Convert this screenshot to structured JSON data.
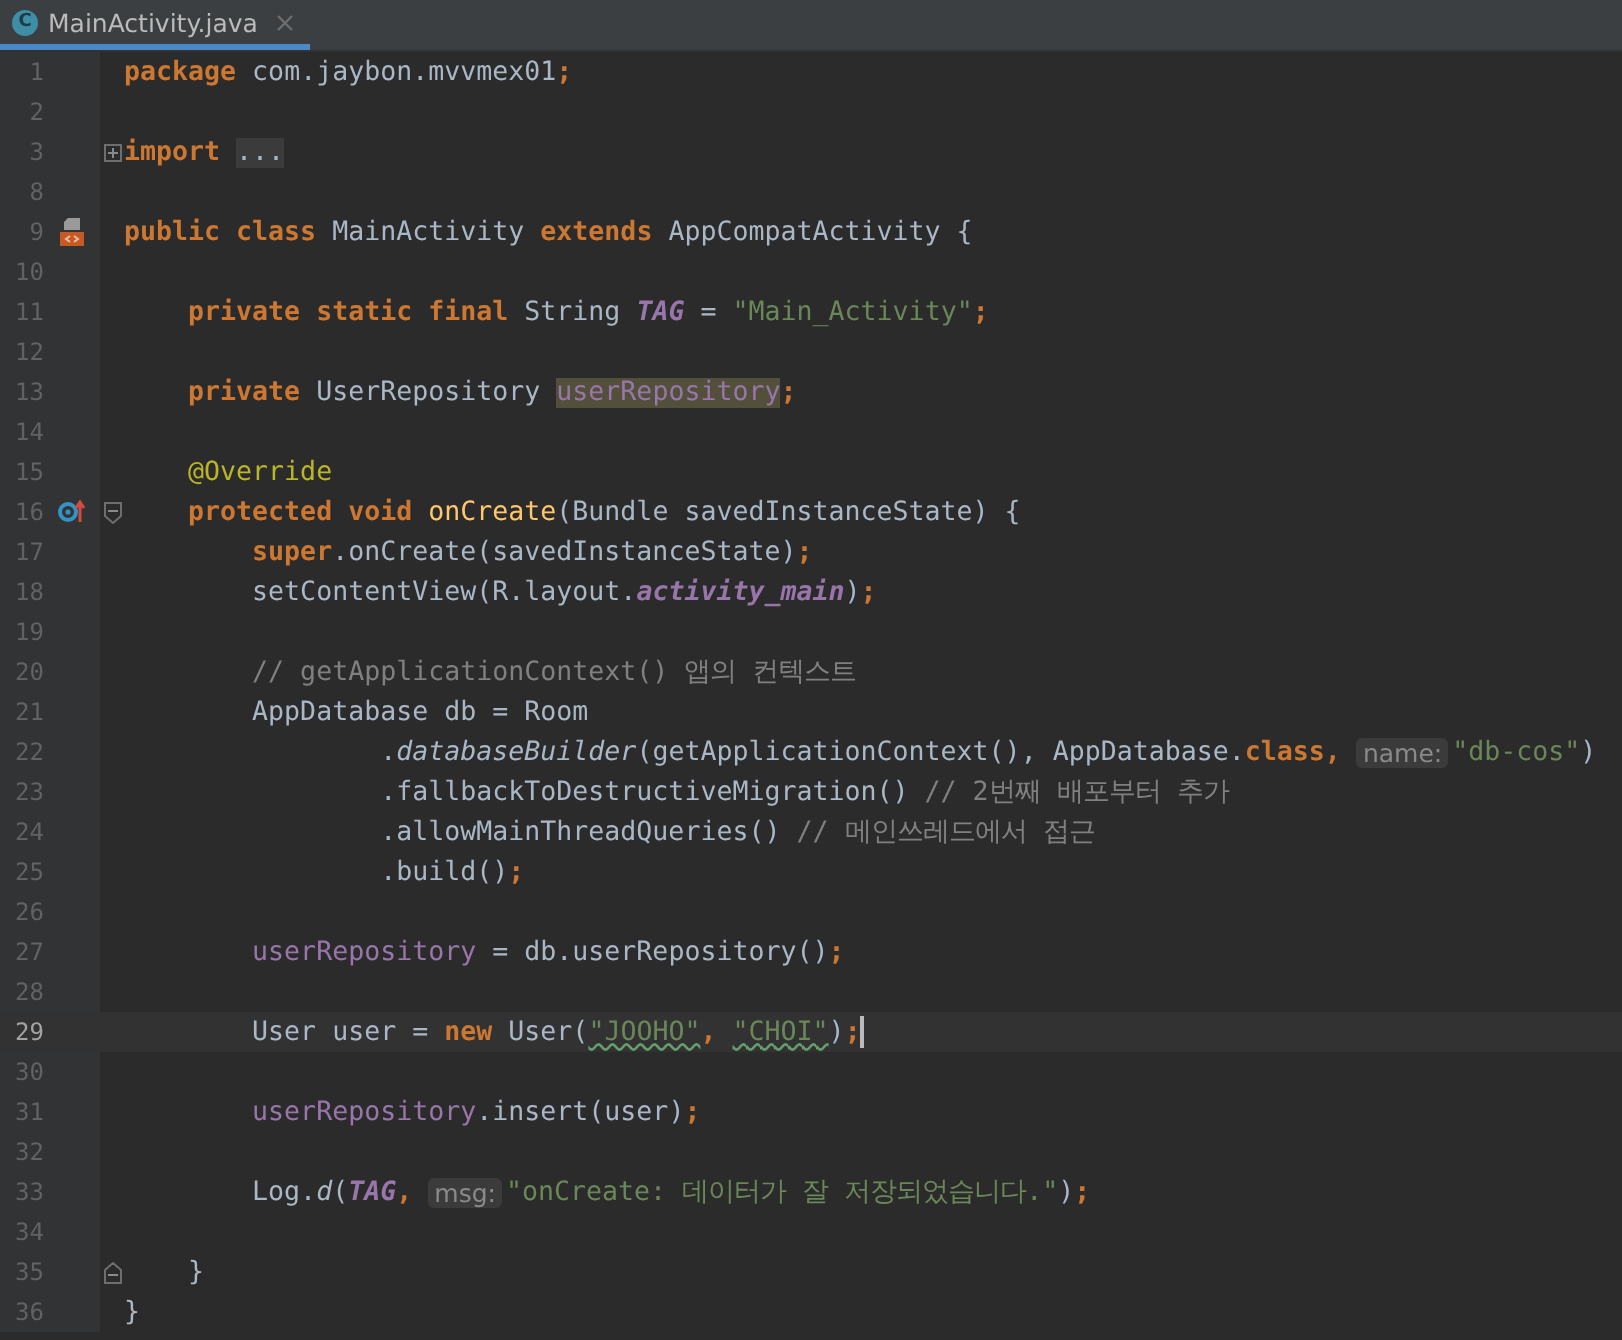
{
  "tabs": [
    {
      "label": "MainActivity.java",
      "badge": "C",
      "selected": true
    }
  ],
  "lines": [
    {
      "number": "1",
      "tokens": [
        {
          "t": "package",
          "kind": "kw"
        },
        {
          "t": " com.jaybon.mvvmex01",
          "kind": "plain"
        },
        {
          "t": ";",
          "kind": "kw"
        }
      ]
    },
    {
      "number": "2"
    },
    {
      "number": "3",
      "fold": {
        "kind": "collapsed"
      },
      "tokens": [
        {
          "t": "import ",
          "kind": "kw"
        },
        {
          "t": "...",
          "kind": "folded"
        }
      ]
    },
    {
      "number": "8"
    },
    {
      "number": "9",
      "gutter_icon": {
        "kind": "layout"
      },
      "tokens": [
        {
          "t": "public class",
          "kind": "kw"
        },
        {
          "t": " MainActivity ",
          "kind": "plain"
        },
        {
          "t": "extends",
          "kind": "kw"
        },
        {
          "t": " AppCompatActivity {",
          "kind": "plain"
        }
      ]
    },
    {
      "number": "10"
    },
    {
      "number": "11",
      "tokens": [
        {
          "t": "    private static final",
          "kind": "kw"
        },
        {
          "t": " String ",
          "kind": "plain"
        },
        {
          "t": "TAG",
          "kind": "static"
        },
        {
          "t": " = ",
          "kind": "plain"
        },
        {
          "t": "\"Main_Activity\"",
          "kind": "str"
        },
        {
          "t": ";",
          "kind": "kw"
        }
      ]
    },
    {
      "number": "12"
    },
    {
      "number": "13",
      "tokens": [
        {
          "t": "    private",
          "kind": "kw"
        },
        {
          "t": " UserRepository ",
          "kind": "plain"
        },
        {
          "t": "userRepository",
          "kind": "field",
          "highlight": true
        },
        {
          "t": ";",
          "kind": "kw"
        }
      ]
    },
    {
      "number": "14"
    },
    {
      "number": "15",
      "tokens": [
        {
          "t": "    @Override",
          "kind": "annot"
        }
      ]
    },
    {
      "number": "16",
      "gutter_icon": {
        "kind": "override"
      },
      "fold": {
        "kind": "expanded"
      },
      "tokens": [
        {
          "t": "    protected void ",
          "kind": "kw"
        },
        {
          "t": "onCreate",
          "kind": "fn"
        },
        {
          "t": "(Bundle savedInstanceState) {",
          "kind": "plain"
        }
      ]
    },
    {
      "number": "17",
      "tokens": [
        {
          "t": "        super",
          "kind": "kw"
        },
        {
          "t": ".onCreate(savedInstanceState)",
          "kind": "plain"
        },
        {
          "t": ";",
          "kind": "kw"
        }
      ]
    },
    {
      "number": "18",
      "tokens": [
        {
          "t": "        setContentView(R.layout.",
          "kind": "plain"
        },
        {
          "t": "activity_main",
          "kind": "static"
        },
        {
          "t": ")",
          "kind": "plain"
        },
        {
          "t": ";",
          "kind": "kw"
        }
      ]
    },
    {
      "number": "19"
    },
    {
      "number": "20",
      "tokens": [
        {
          "t": "        // getApplicationContext() 앱의 컨텍스트",
          "kind": "comment"
        }
      ]
    },
    {
      "number": "21",
      "tokens": [
        {
          "t": "        AppDatabase db = Room",
          "kind": "plain"
        }
      ]
    },
    {
      "number": "22",
      "tokens": [
        {
          "t": "                .",
          "kind": "plain"
        },
        {
          "t": "databaseBuilder",
          "kind": "smethod"
        },
        {
          "t": "(getApplicationContext(), AppDatabase.",
          "kind": "plain"
        },
        {
          "t": "class, ",
          "kind": "kw"
        },
        {
          "t": "name:",
          "kind": "hint"
        },
        {
          "t": "\"db-cos\"",
          "kind": "str"
        },
        {
          "t": ")",
          "kind": "plain"
        }
      ]
    },
    {
      "number": "23",
      "tokens": [
        {
          "t": "                .fallbackToDestructiveMigration() ",
          "kind": "plain"
        },
        {
          "t": "// 2번째 배포부터 추가",
          "kind": "comment"
        }
      ]
    },
    {
      "number": "24",
      "tokens": [
        {
          "t": "                .allowMainThreadQueries() ",
          "kind": "plain"
        },
        {
          "t": "// 메인쓰레드에서 접근",
          "kind": "comment"
        }
      ]
    },
    {
      "number": "25",
      "tokens": [
        {
          "t": "                .build()",
          "kind": "plain"
        },
        {
          "t": ";",
          "kind": "kw"
        }
      ]
    },
    {
      "number": "26"
    },
    {
      "number": "27",
      "tokens": [
        {
          "t": "        userRepository",
          "kind": "field"
        },
        {
          "t": " = db.userRepository()",
          "kind": "plain"
        },
        {
          "t": ";",
          "kind": "kw"
        }
      ]
    },
    {
      "number": "28"
    },
    {
      "number": "29",
      "current": true,
      "caret": true,
      "tokens": [
        {
          "t": "        User user = ",
          "kind": "plain"
        },
        {
          "t": "new",
          "kind": "kw"
        },
        {
          "t": " User(",
          "kind": "plain"
        },
        {
          "t": "\"JOOHO\"",
          "kind": "str",
          "typo": true
        },
        {
          "t": ", ",
          "kind": "kw"
        },
        {
          "t": "\"CHOI\"",
          "kind": "str",
          "typo": true
        },
        {
          "t": ")",
          "kind": "plain"
        },
        {
          "t": ";",
          "kind": "kw"
        }
      ]
    },
    {
      "number": "30"
    },
    {
      "number": "31",
      "tokens": [
        {
          "t": "        userRepository",
          "kind": "field"
        },
        {
          "t": ".insert(user)",
          "kind": "plain"
        },
        {
          "t": ";",
          "kind": "kw"
        }
      ]
    },
    {
      "number": "32"
    },
    {
      "number": "33",
      "tokens": [
        {
          "t": "        Log.",
          "kind": "plain"
        },
        {
          "t": "d",
          "kind": "smethod"
        },
        {
          "t": "(",
          "kind": "plain"
        },
        {
          "t": "TAG",
          "kind": "static"
        },
        {
          "t": ", ",
          "kind": "kw"
        },
        {
          "t": "msg:",
          "kind": "hint"
        },
        {
          "t": "\"onCreate: 데이터가 잘 저장되었습니다.\"",
          "kind": "str"
        },
        {
          "t": ")",
          "kind": "plain"
        },
        {
          "t": ";",
          "kind": "kw"
        }
      ]
    },
    {
      "number": "34"
    },
    {
      "number": "35",
      "fold": {
        "kind": "end"
      },
      "tokens": [
        {
          "t": "    }",
          "kind": "plain"
        }
      ]
    },
    {
      "number": "36",
      "tokens": [
        {
          "t": "}",
          "kind": "plain"
        }
      ]
    }
  ]
}
